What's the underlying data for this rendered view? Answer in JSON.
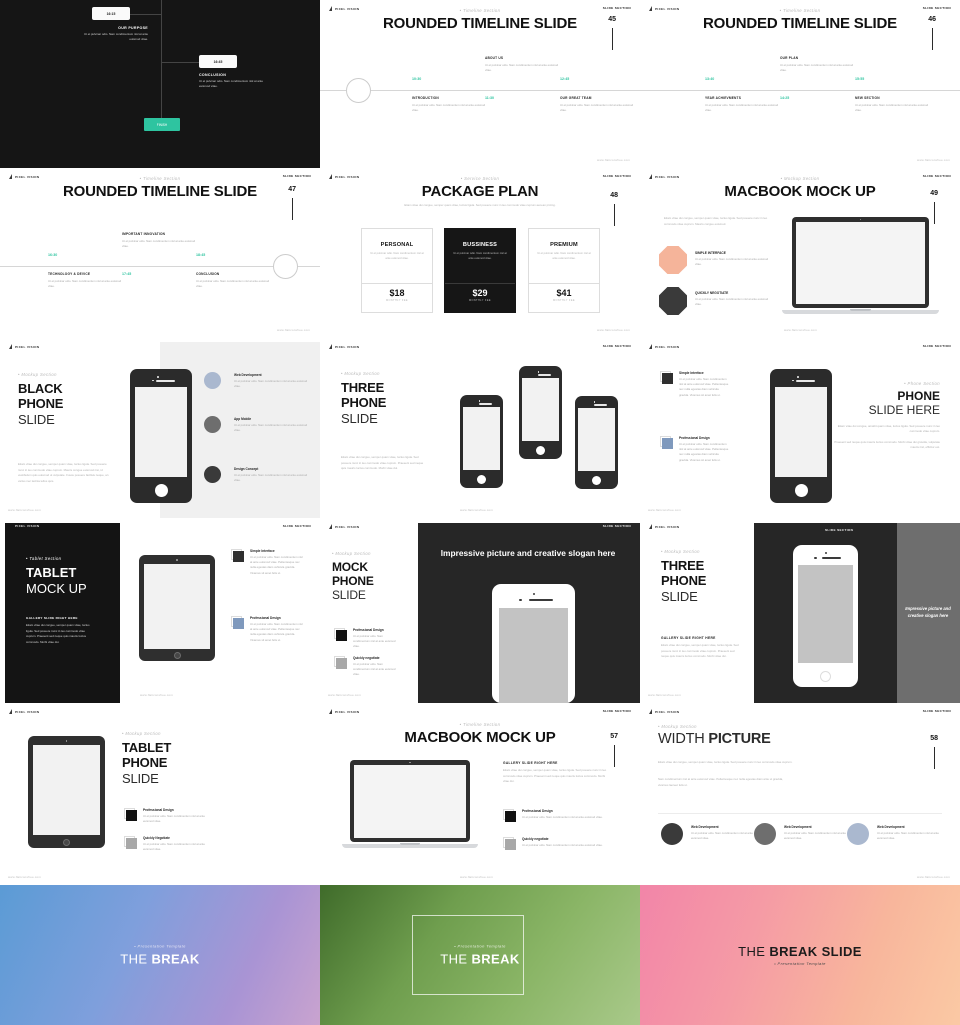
{
  "meta": {
    "header_left": "PIXEL VISION",
    "header_right": "SLIDE SECTION",
    "footer_url": "www.flaticonsfree.com"
  },
  "lorem": {
    "short": "Ut et pulvinar odio. Nam condimentum nisl at ante euismod vitae.",
    "cell": "Ut et pulvinar odio. Nam condimentum nisl at ante euismod vitae.",
    "tiny": "Ut et pulvinar odio. Nam condimentum nisl at ante euismod vitae.",
    "long": "Etiam vitae dui congue, semper quam vitae, luctus ligula. Sed posuere nunc in leo commodo vitae cuprum. Mauris congue euismod nisi, id vestibulum quis euismod ut vulputate. Fusce posuere facilisis neque, an varius nec lacinia tellus quis.",
    "med": "Etiam vitae dui congue, semper quam vitae, luctus ligula. Sed posuere nunc in leo commodo vitae cuprum. Praesent sed neque quis mauris luctus commodo. Morbi vitae dui.",
    "pkg": "Etiam vitae dui congue, semper quam vitae, luctus ligula. Sed posuere nunc in leo commodo vitae cuprum aenean pricing.",
    "mac": "Etiam vitae dui congue, semper quam vitae, luctus ligula. Sed posuere nunc in leo commodo vitae cuprum. Mauris congue euismod.",
    "phone_right_1": "Etiam vitae dui congue, amabit quam vitae, luctus ligula. Sed posuere nunc in leo commodo vitae cuprum.",
    "phone_right_2": "Praesent sed neque quis mauris luctus commodo. Morbi vitae dui gravida, vulputate mauris nisl, efficitur est.",
    "feature_long": "Ut et pulvinar odio. Nam condimentum nisl at ante euismod vitae. Pellentesque nec nulla egestas diam vehicula gravida. Vivamus sit amet felis ut.",
    "width_p1": "Etiam vitae dui congue, semper quam vitae, luctus ligula. Sed posuere nunc in leo commodo vitae cuprum.",
    "width_p2": "Nam condimentum nisl at ante euismod vitae. Pellentesque nec nulla egestas diam ante ut gravida, vivamus laoreet felis ut."
  },
  "slides": {
    "s44": {
      "chip1": "16:15",
      "chip2": "16:45",
      "item1": {
        "title": "OUR PURPOSE"
      },
      "item2": {
        "title": "CONCLUSION"
      },
      "button": "FINISH"
    },
    "s45": {
      "eyebrow": "• Timeline Section",
      "title": "ROUNDED TIMELINE SLIDE",
      "page": "45",
      "times": [
        "10:30",
        "11:30",
        "12:45"
      ],
      "items": [
        {
          "title": "ABOUT US"
        },
        {
          "title": "INTRODUCTION"
        },
        {
          "title": "OUR GREAT TEAM"
        }
      ]
    },
    "s46": {
      "eyebrow": "• Timeline Section",
      "title": "ROUNDED TIMELINE SLIDE",
      "page": "46",
      "times": [
        "13:40",
        "14:25",
        "15:55"
      ],
      "items": [
        {
          "title": "OUR PLAN"
        },
        {
          "title": "YEAR ACHIEVMENTS"
        },
        {
          "title": "NEW SECTION"
        }
      ]
    },
    "s47": {
      "eyebrow": "• Timeline Section",
      "title": "ROUNDED TIMELINE SLIDE",
      "page": "47",
      "times": [
        "16:30",
        "17:45",
        "18:45"
      ],
      "items": [
        {
          "title": "IMPORTANT INNOVATION"
        },
        {
          "title": "TECHNOLOGY & DEVICE"
        },
        {
          "title": "CONCLUSION"
        }
      ]
    },
    "s48": {
      "eyebrow": "• Service Section",
      "title": "PACKAGE PLAN",
      "page": "48",
      "cards": [
        {
          "name": "PERSONAL",
          "price": "$18",
          "sub": "MONTHLY FEE"
        },
        {
          "name": "BUSSINESS",
          "price": "$29",
          "sub": "MONTHLY FEE"
        },
        {
          "name": "PREMIUM",
          "price": "$41",
          "sub": "MONTHLY FEE"
        }
      ]
    },
    "s49": {
      "eyebrow": "• Mockup Section",
      "title": "MACBOOK MOCK UP",
      "page": "49",
      "features": [
        {
          "title": "SIMPLE INTERFACE",
          "color": "#f5b49a"
        },
        {
          "title": "QUICKLY NEGOTIATE",
          "color": "#3a3a3a"
        }
      ]
    },
    "s50": {
      "eyebrow": "• Mockup Section",
      "title_line1": "BLACK",
      "title_line2": "PHONE",
      "title_line3": "SLIDE",
      "features": [
        {
          "title": "Web Development",
          "color": "#aab8cf"
        },
        {
          "title": "App Mobile",
          "color": "#6e6e6e"
        },
        {
          "title": "Design Concept",
          "color": "#3a3a3a"
        }
      ]
    },
    "s51": {
      "eyebrow": "• Mockup Section",
      "title_line1": "THREE",
      "title_line2": "PHONE",
      "title_line3": "SLIDE"
    },
    "s52": {
      "eyebrow": "• Phone Section",
      "title_line1": "PHONE",
      "title_line2": "SLIDE HERE",
      "features": [
        {
          "title": "Simple Interface",
          "color": "#2f2f2f"
        },
        {
          "title": "Professional Design",
          "color": "#7f99bd"
        }
      ]
    },
    "s53": {
      "eyebrow": "• Tablet Section",
      "title_line1": "TABLET",
      "title_line2": "MOCK UP",
      "gallery_head": "GALLERY SLIDE RIGHT HERE",
      "features": [
        {
          "title": "Simple Interface",
          "color": "#2f2f2f"
        },
        {
          "title": "Professional Design",
          "color": "#7f99bd"
        }
      ]
    },
    "s54": {
      "eyebrow": "• Mockup Section",
      "title_line1": "MOCK",
      "title_line2": "PHONE",
      "title_line3": "SLIDE",
      "slogan": "Impressive picture and creative slogan here",
      "features": [
        {
          "title": "Professional Design",
          "color": "#111111"
        },
        {
          "title": "Quickly negotiate",
          "color": "#a8a8a8"
        }
      ]
    },
    "s55": {
      "eyebrow": "• Mockup Section",
      "title_line1": "THREE",
      "title_line2": "PHONE",
      "title_line3": "SLIDE",
      "gallery_head": "GALLERY SLIDE RIGHT HERE",
      "slogan": "Impressive picture and creative slogan here",
      "header_center": "SLIDE SECTION"
    },
    "s56": {
      "eyebrow": "• Mockup Section",
      "title_line1": "TABLET",
      "title_line2": "PHONE",
      "title_line3": "SLIDE",
      "features": [
        {
          "title": "Professional Design",
          "color": "#111111"
        },
        {
          "title": "Quickly Negotiate",
          "color": "#a8a8a8"
        }
      ]
    },
    "s57": {
      "eyebrow": "• Timeline Section",
      "title": "MACBOOK MOCK UP",
      "page": "57",
      "gallery_head": "GALLERY SLIDE RIGHT HERE",
      "features": [
        {
          "title": "Professional Design",
          "color": "#111111"
        },
        {
          "title": "Quickly negotiate",
          "color": "#a8a8a8"
        }
      ]
    },
    "s58": {
      "eyebrow": "• Mockup Section",
      "title_light": "WIDTH ",
      "title_bold": "PICTURE",
      "page": "58",
      "features": [
        {
          "title": "Web Development",
          "color": "#3a3a3a"
        },
        {
          "title": "Web Development",
          "color": "#6e6e6e"
        },
        {
          "title": "Web Development",
          "color": "#aab8cf"
        }
      ]
    },
    "break1": {
      "eyebrow": "• Presentation Template",
      "title_light": "THE ",
      "title_bold": "BREAK"
    },
    "break2": {
      "eyebrow": "• Presentation Template",
      "title_light": "THE ",
      "title_bold": "BREAK"
    },
    "break3": {
      "title_light": "THE ",
      "title_bold": "BREAK SLIDE",
      "eyebrow": "• Presentation Template"
    }
  }
}
